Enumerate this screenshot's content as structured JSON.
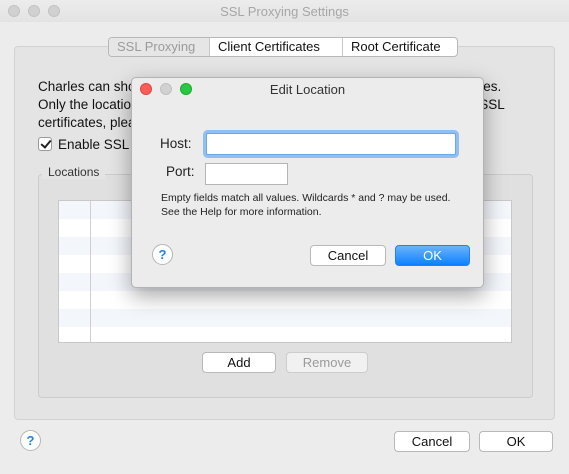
{
  "window": {
    "title": "SSL Proxying Settings"
  },
  "tabs": [
    {
      "label": "SSL Proxying",
      "selected": true
    },
    {
      "label": "Client Certificates",
      "selected": false
    },
    {
      "label": "Root Certificate",
      "selected": false
    }
  ],
  "description": {
    "line1": "Charles can show you the plain text contents of SSL requests and responses.",
    "line2": "Only the locations listed below will be proxied. Charles will issue and sign SSL",
    "line3": "certificates, please press the Help button for more information."
  },
  "enable_ssl": {
    "label": "Enable SSL Proxying",
    "checked": true
  },
  "locations": {
    "legend": "Locations",
    "add_label": "Add",
    "remove_label": "Remove"
  },
  "footer": {
    "help_label": "?",
    "cancel_label": "Cancel",
    "ok_label": "OK"
  },
  "dialog": {
    "title": "Edit Location",
    "host_label": "Host:",
    "host_value": "",
    "port_label": "Port:",
    "port_value": "",
    "note": "Empty fields match all values. Wildcards * and ? may be used. See the Help for more information.",
    "help_label": "?",
    "cancel_label": "Cancel",
    "ok_label": "OK"
  },
  "colors": {
    "accent": "#0d81ff",
    "focus_ring": "#90bff3"
  }
}
